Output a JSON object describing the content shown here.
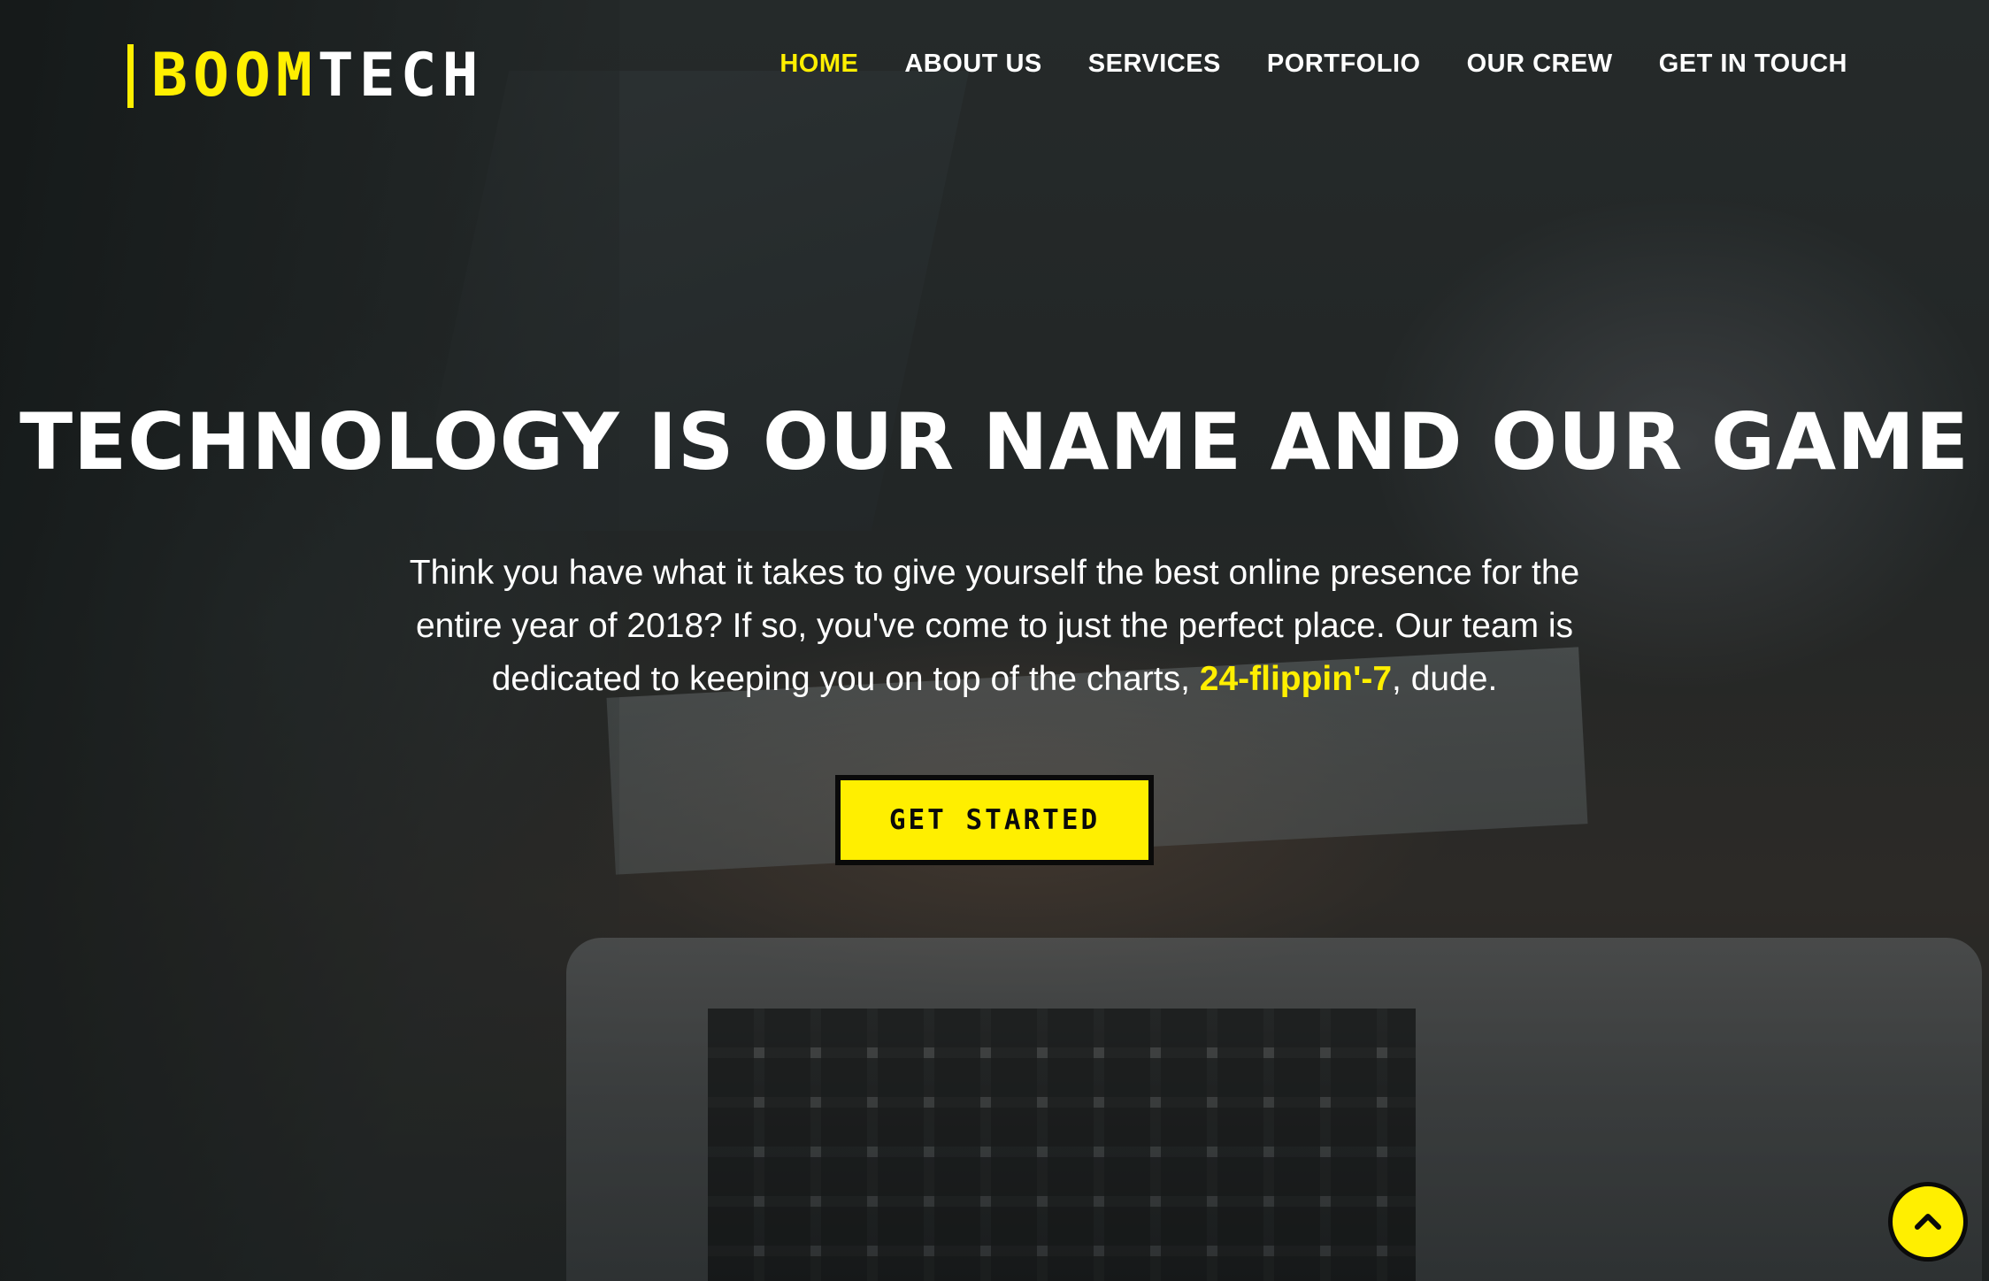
{
  "brand": {
    "part1": "BOOM",
    "part2": "TECH"
  },
  "nav": {
    "items": [
      {
        "label": "HOME"
      },
      {
        "label": "ABOUT US"
      },
      {
        "label": "SERVICES"
      },
      {
        "label": "PORTFOLIO"
      },
      {
        "label": "OUR CREW"
      },
      {
        "label": "GET IN TOUCH"
      }
    ],
    "active": "HOME"
  },
  "hero": {
    "headline": "TECHNOLOGY IS OUR NAME AND OUR GAME",
    "lead_line1": "Think you have what it takes to give yourself the best online presence for the",
    "lead_line2": "entire year of 2018? If so, you've come to just the perfect place. Our team is",
    "lead_line3_pre": "dedicated to keeping you on top of the charts, ",
    "lead_highlight": "24-flippin'-7",
    "lead_line3_post": ", dude.",
    "cta_label": "GET STARTED"
  },
  "scroll_top": {
    "icon": "chevron-up-icon"
  },
  "colors": {
    "accent": "#ffef00",
    "text": "#ffffff",
    "dark": "#0a0a0a"
  }
}
